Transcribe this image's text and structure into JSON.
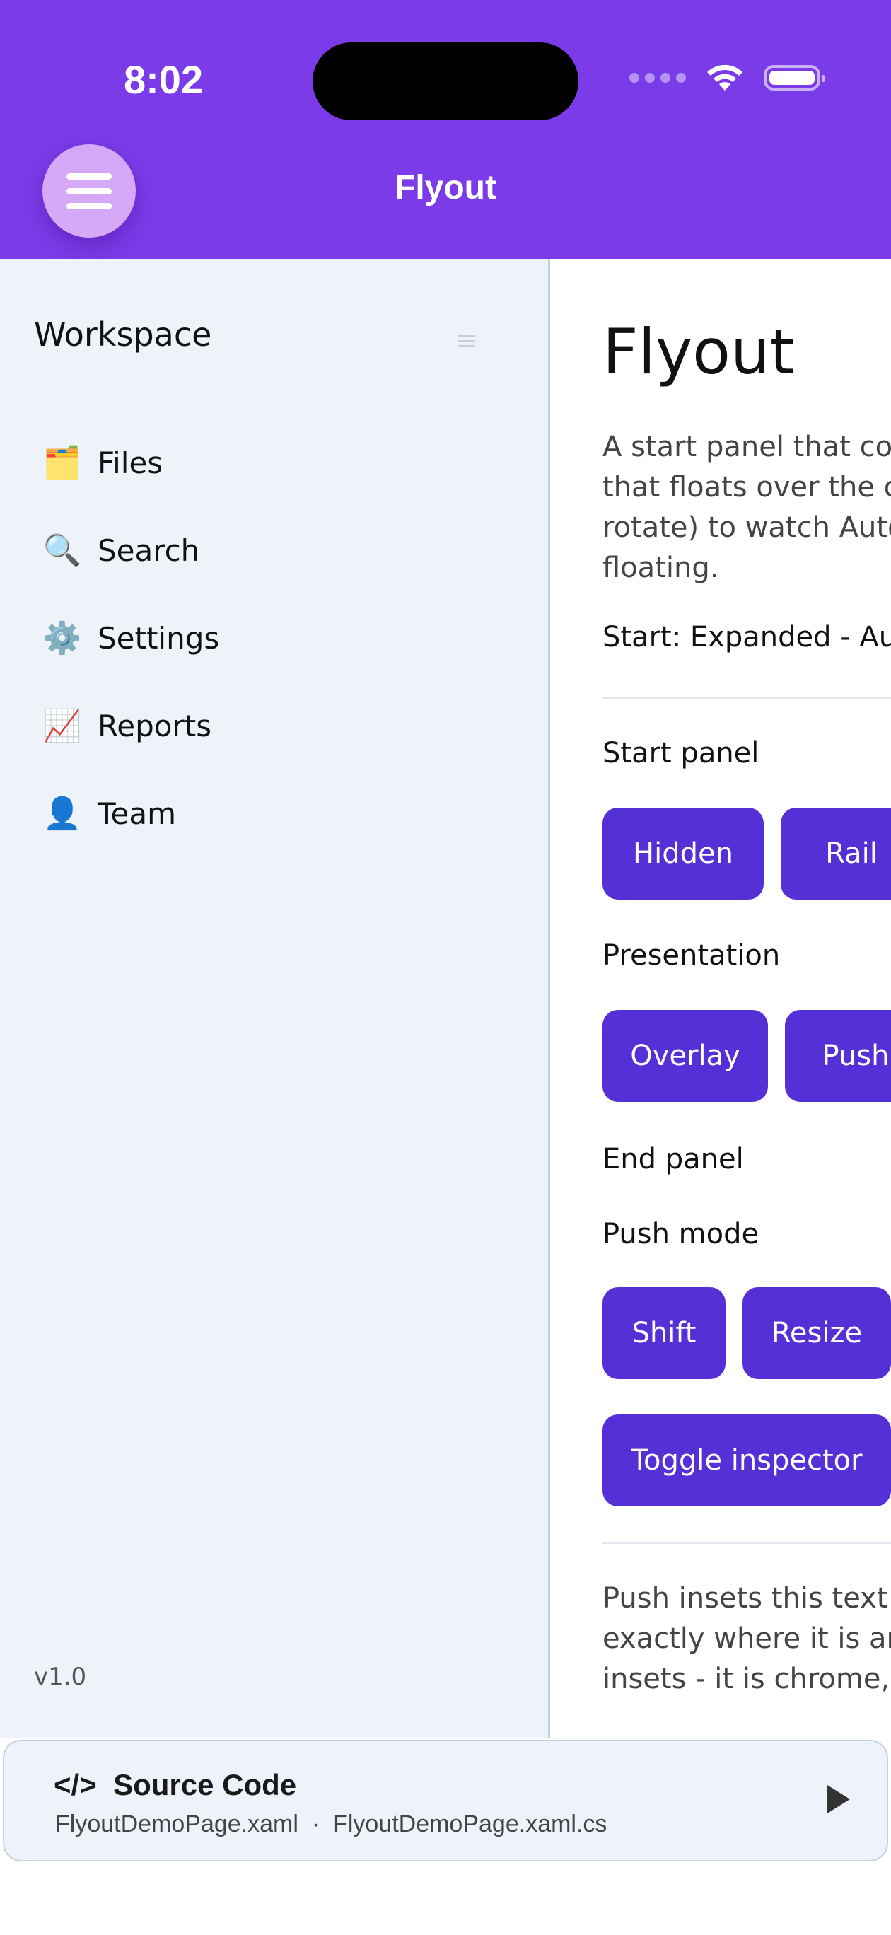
{
  "status_bar": {
    "time": "8:02"
  },
  "header": {
    "title": "Flyout",
    "menu_icon": "hamburger-icon"
  },
  "sidebar": {
    "title": "Workspace",
    "items": [
      {
        "emoji": "🗂️",
        "label": "Files"
      },
      {
        "emoji": "🔍",
        "label": "Search"
      },
      {
        "emoji": "⚙️",
        "label": "Settings"
      },
      {
        "emoji": "📈",
        "label": "Reports"
      },
      {
        "emoji": "👤",
        "label": "Team"
      }
    ],
    "version": "v1.0"
  },
  "main": {
    "title": "Flyout",
    "description_lines": [
      "A start panel that coll",
      "that floats over the co",
      "rotate) to watch Auto",
      "floating."
    ],
    "state_text": "Start: Expanded - Aut",
    "start_panel_label": "Start panel",
    "start_panel_buttons": [
      "Hidden",
      "Rail"
    ],
    "presentation_label": "Presentation",
    "presentation_buttons": [
      "Overlay",
      "Push"
    ],
    "end_panel_label": "End panel",
    "push_mode_label": "Push mode",
    "push_mode_buttons": [
      "Shift",
      "Resize"
    ],
    "toggle_inspector": "Toggle inspector",
    "footer_lines": [
      "Push insets this text a",
      "exactly where it is an",
      "insets - it is chrome, n"
    ]
  },
  "source_bar": {
    "icon": "</>",
    "title": "Source Code",
    "file1": "FlyoutDemoPage.xaml",
    "separator": "·",
    "file2": "FlyoutDemoPage.xaml.cs"
  },
  "colors": {
    "header": "#7b3be9",
    "button": "#5530d6",
    "sidebar": "#eef3fa"
  }
}
